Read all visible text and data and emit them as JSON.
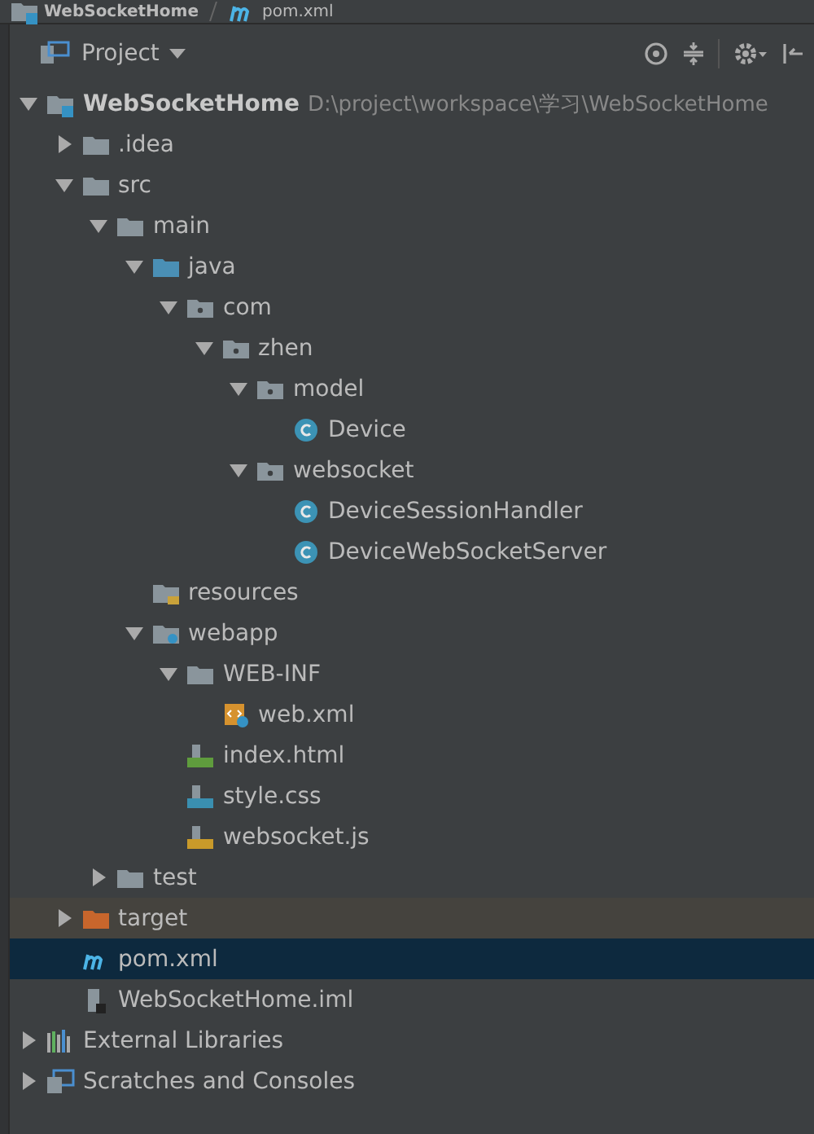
{
  "breadcrumb": [
    {
      "label": "WebSocketHome",
      "kind": "module"
    },
    {
      "label": "pom.xml",
      "kind": "maven"
    }
  ],
  "panel": {
    "title": "Project"
  },
  "tree": [
    {
      "label": "WebSocketHome",
      "path": "D:\\project\\workspace\\学习\\WebSocketHome",
      "kind": "module",
      "expanded": true,
      "selected": false,
      "children": [
        {
          "label": ".idea",
          "kind": "folder",
          "expanded": false,
          "selected": false
        },
        {
          "label": "src",
          "kind": "folder",
          "expanded": true,
          "selected": false,
          "children": [
            {
              "label": "main",
              "kind": "folder",
              "expanded": true,
              "selected": false,
              "children": [
                {
                  "label": "java",
                  "kind": "source",
                  "expanded": true,
                  "selected": false,
                  "children": [
                    {
                      "label": "com",
                      "kind": "package",
                      "expanded": true,
                      "selected": false,
                      "children": [
                        {
                          "label": "zhen",
                          "kind": "package",
                          "expanded": true,
                          "selected": false,
                          "children": [
                            {
                              "label": "model",
                              "kind": "package",
                              "expanded": true,
                              "selected": false,
                              "children": [
                                {
                                  "label": "Device",
                                  "kind": "class",
                                  "selected": false
                                }
                              ]
                            },
                            {
                              "label": "websocket",
                              "kind": "package",
                              "expanded": true,
                              "selected": false,
                              "children": [
                                {
                                  "label": "DeviceSessionHandler",
                                  "kind": "class",
                                  "selected": false
                                },
                                {
                                  "label": "DeviceWebSocketServer",
                                  "kind": "class",
                                  "selected": false
                                }
                              ]
                            }
                          ]
                        }
                      ]
                    }
                  ]
                },
                {
                  "label": "resources",
                  "kind": "resources",
                  "selected": false
                },
                {
                  "label": "webapp",
                  "kind": "webfolder",
                  "expanded": true,
                  "selected": false,
                  "children": [
                    {
                      "label": "WEB-INF",
                      "kind": "folder",
                      "expanded": true,
                      "selected": false,
                      "children": [
                        {
                          "label": "web.xml",
                          "kind": "xml",
                          "selected": false
                        }
                      ]
                    },
                    {
                      "label": "index.html",
                      "kind": "html",
                      "selected": false
                    },
                    {
                      "label": "style.css",
                      "kind": "css",
                      "selected": false
                    },
                    {
                      "label": "websocket.js",
                      "kind": "js",
                      "selected": false
                    }
                  ]
                }
              ]
            },
            {
              "label": "test",
              "kind": "folder",
              "expanded": false,
              "selected": false
            }
          ]
        },
        {
          "label": "target",
          "kind": "excluded",
          "expanded": false,
          "selected": false
        },
        {
          "label": "pom.xml",
          "kind": "maven",
          "selected": true
        },
        {
          "label": "WebSocketHome.iml",
          "kind": "iml",
          "selected": false
        }
      ]
    },
    {
      "label": "External Libraries",
      "kind": "libraries",
      "expanded": false,
      "selected": false
    },
    {
      "label": "Scratches and Consoles",
      "kind": "scratches",
      "expanded": false,
      "selected": false
    }
  ]
}
